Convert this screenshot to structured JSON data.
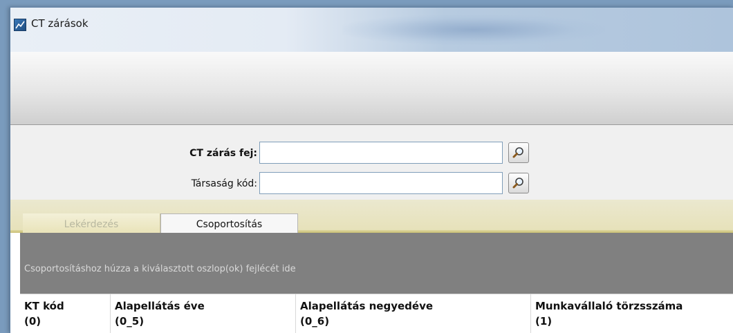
{
  "window": {
    "title": "CT zárások"
  },
  "filters": {
    "ct_close_header": {
      "label": "CT zárás fej:",
      "value": ""
    },
    "company_code": {
      "label": "Társaság kód:",
      "value": ""
    }
  },
  "tabs": [
    {
      "label": "Lekérdezés",
      "state": "disabled"
    },
    {
      "label": "Csoportosítás",
      "state": "active"
    }
  ],
  "grid": {
    "group_hint": "Csoportosításhoz húzza a kiválasztott oszlop(ok) fejlécét ide",
    "columns": [
      {
        "title": "KT kód",
        "code": "(0)"
      },
      {
        "title": "Alapellátás éve",
        "code": "(0_5)"
      },
      {
        "title": "Alapellátás negyedéve",
        "code": "(0_6)"
      },
      {
        "title": "Munkavállaló törzsszáma",
        "code": "(1)"
      }
    ]
  },
  "icons": {
    "app": "app-icon",
    "lookup": "magnifier-icon"
  }
}
